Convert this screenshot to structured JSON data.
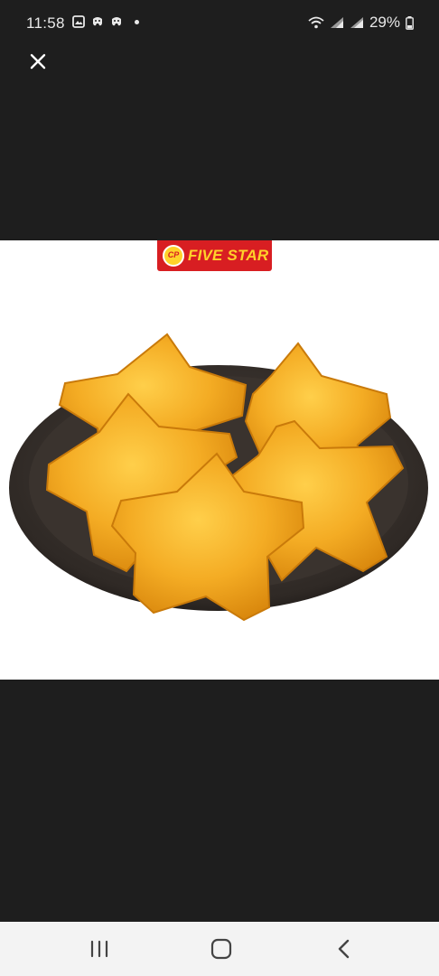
{
  "status_bar": {
    "time": "11:58",
    "battery": "29%",
    "left_icons": [
      "gallery-icon",
      "game-icon",
      "game-icon",
      "notification-dot"
    ],
    "right_icons": [
      "wifi-icon",
      "signal-icon",
      "signal-icon",
      "battery-icon"
    ]
  },
  "viewer": {
    "close_icon": "close-icon",
    "background_color": "#1e1e1e"
  },
  "image": {
    "brand_logo": "CP",
    "brand_name": "FIVE STAR",
    "brand_color": "#d81e22",
    "brand_text_color": "#ffd22a"
  },
  "nav_bar": {
    "buttons": [
      "recent-apps-icon",
      "home-icon",
      "back-icon"
    ]
  }
}
